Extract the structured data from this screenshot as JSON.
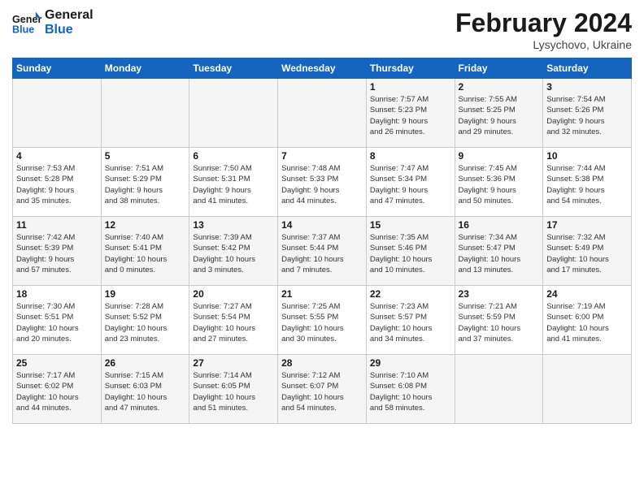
{
  "header": {
    "logo_general": "General",
    "logo_blue": "Blue",
    "month_title": "February 2024",
    "location": "Lysychovo, Ukraine"
  },
  "days_of_week": [
    "Sunday",
    "Monday",
    "Tuesday",
    "Wednesday",
    "Thursday",
    "Friday",
    "Saturday"
  ],
  "weeks": [
    [
      {
        "day": "",
        "info": ""
      },
      {
        "day": "",
        "info": ""
      },
      {
        "day": "",
        "info": ""
      },
      {
        "day": "",
        "info": ""
      },
      {
        "day": "1",
        "info": "Sunrise: 7:57 AM\nSunset: 5:23 PM\nDaylight: 9 hours\nand 26 minutes."
      },
      {
        "day": "2",
        "info": "Sunrise: 7:55 AM\nSunset: 5:25 PM\nDaylight: 9 hours\nand 29 minutes."
      },
      {
        "day": "3",
        "info": "Sunrise: 7:54 AM\nSunset: 5:26 PM\nDaylight: 9 hours\nand 32 minutes."
      }
    ],
    [
      {
        "day": "4",
        "info": "Sunrise: 7:53 AM\nSunset: 5:28 PM\nDaylight: 9 hours\nand 35 minutes."
      },
      {
        "day": "5",
        "info": "Sunrise: 7:51 AM\nSunset: 5:29 PM\nDaylight: 9 hours\nand 38 minutes."
      },
      {
        "day": "6",
        "info": "Sunrise: 7:50 AM\nSunset: 5:31 PM\nDaylight: 9 hours\nand 41 minutes."
      },
      {
        "day": "7",
        "info": "Sunrise: 7:48 AM\nSunset: 5:33 PM\nDaylight: 9 hours\nand 44 minutes."
      },
      {
        "day": "8",
        "info": "Sunrise: 7:47 AM\nSunset: 5:34 PM\nDaylight: 9 hours\nand 47 minutes."
      },
      {
        "day": "9",
        "info": "Sunrise: 7:45 AM\nSunset: 5:36 PM\nDaylight: 9 hours\nand 50 minutes."
      },
      {
        "day": "10",
        "info": "Sunrise: 7:44 AM\nSunset: 5:38 PM\nDaylight: 9 hours\nand 54 minutes."
      }
    ],
    [
      {
        "day": "11",
        "info": "Sunrise: 7:42 AM\nSunset: 5:39 PM\nDaylight: 9 hours\nand 57 minutes."
      },
      {
        "day": "12",
        "info": "Sunrise: 7:40 AM\nSunset: 5:41 PM\nDaylight: 10 hours\nand 0 minutes."
      },
      {
        "day": "13",
        "info": "Sunrise: 7:39 AM\nSunset: 5:42 PM\nDaylight: 10 hours\nand 3 minutes."
      },
      {
        "day": "14",
        "info": "Sunrise: 7:37 AM\nSunset: 5:44 PM\nDaylight: 10 hours\nand 7 minutes."
      },
      {
        "day": "15",
        "info": "Sunrise: 7:35 AM\nSunset: 5:46 PM\nDaylight: 10 hours\nand 10 minutes."
      },
      {
        "day": "16",
        "info": "Sunrise: 7:34 AM\nSunset: 5:47 PM\nDaylight: 10 hours\nand 13 minutes."
      },
      {
        "day": "17",
        "info": "Sunrise: 7:32 AM\nSunset: 5:49 PM\nDaylight: 10 hours\nand 17 minutes."
      }
    ],
    [
      {
        "day": "18",
        "info": "Sunrise: 7:30 AM\nSunset: 5:51 PM\nDaylight: 10 hours\nand 20 minutes."
      },
      {
        "day": "19",
        "info": "Sunrise: 7:28 AM\nSunset: 5:52 PM\nDaylight: 10 hours\nand 23 minutes."
      },
      {
        "day": "20",
        "info": "Sunrise: 7:27 AM\nSunset: 5:54 PM\nDaylight: 10 hours\nand 27 minutes."
      },
      {
        "day": "21",
        "info": "Sunrise: 7:25 AM\nSunset: 5:55 PM\nDaylight: 10 hours\nand 30 minutes."
      },
      {
        "day": "22",
        "info": "Sunrise: 7:23 AM\nSunset: 5:57 PM\nDaylight: 10 hours\nand 34 minutes."
      },
      {
        "day": "23",
        "info": "Sunrise: 7:21 AM\nSunset: 5:59 PM\nDaylight: 10 hours\nand 37 minutes."
      },
      {
        "day": "24",
        "info": "Sunrise: 7:19 AM\nSunset: 6:00 PM\nDaylight: 10 hours\nand 41 minutes."
      }
    ],
    [
      {
        "day": "25",
        "info": "Sunrise: 7:17 AM\nSunset: 6:02 PM\nDaylight: 10 hours\nand 44 minutes."
      },
      {
        "day": "26",
        "info": "Sunrise: 7:15 AM\nSunset: 6:03 PM\nDaylight: 10 hours\nand 47 minutes."
      },
      {
        "day": "27",
        "info": "Sunrise: 7:14 AM\nSunset: 6:05 PM\nDaylight: 10 hours\nand 51 minutes."
      },
      {
        "day": "28",
        "info": "Sunrise: 7:12 AM\nSunset: 6:07 PM\nDaylight: 10 hours\nand 54 minutes."
      },
      {
        "day": "29",
        "info": "Sunrise: 7:10 AM\nSunset: 6:08 PM\nDaylight: 10 hours\nand 58 minutes."
      },
      {
        "day": "",
        "info": ""
      },
      {
        "day": "",
        "info": ""
      }
    ]
  ]
}
